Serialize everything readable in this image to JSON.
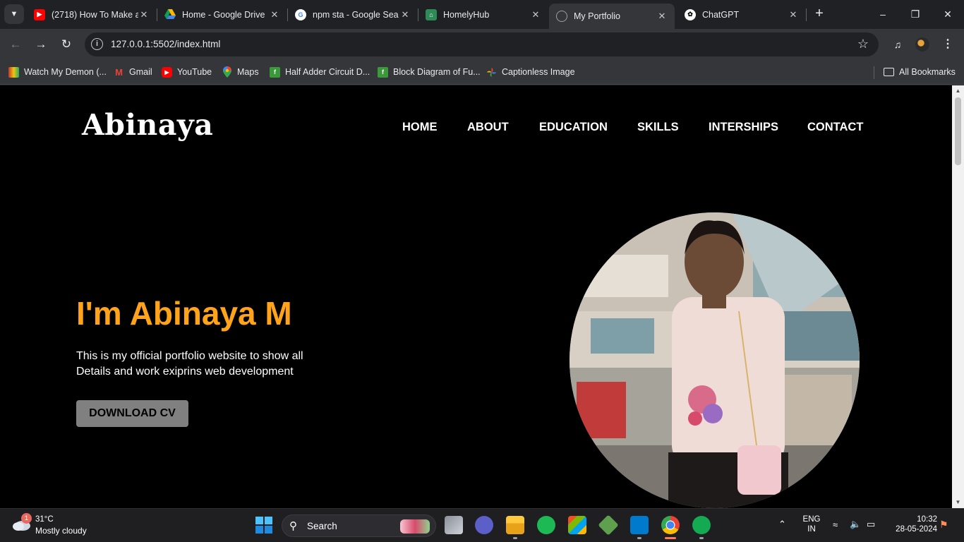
{
  "browser": {
    "tabs": [
      {
        "title": "(2718) How To Make a",
        "icon": "youtube-icon",
        "color": "#ff0000"
      },
      {
        "title": "Home - Google Drive",
        "icon": "google-drive-icon",
        "color": "#1fa463"
      },
      {
        "title": "npm sta - Google Sea",
        "icon": "google-icon",
        "color": "#4285f4"
      },
      {
        "title": "HomelyHub",
        "icon": "house-icon",
        "color": "#2e8b57"
      },
      {
        "title": "My Portfolio",
        "icon": "globe-icon",
        "color": "#9aa0a6",
        "active": true
      },
      {
        "title": "ChatGPT",
        "icon": "chatgpt-icon",
        "color": "#ffffff"
      }
    ],
    "url": "127.0.0.1:5502/index.html",
    "bookmarks": [
      {
        "label": "Watch My Demon (...",
        "icon": "film-icon"
      },
      {
        "label": "Gmail",
        "icon": "gmail-icon"
      },
      {
        "label": "YouTube",
        "icon": "youtube-icon"
      },
      {
        "label": "Maps",
        "icon": "maps-pin-icon"
      },
      {
        "label": "Half Adder Circuit D...",
        "icon": "leaf-icon"
      },
      {
        "label": "Block Diagram of Fu...",
        "icon": "leaf-icon"
      },
      {
        "label": "Captionless Image",
        "icon": "pinwheel-icon"
      }
    ],
    "all_bookmarks": "All Bookmarks"
  },
  "site": {
    "logo": "Abinaya",
    "nav": [
      "HOME",
      "ABOUT",
      "EDUCATION",
      "SKILLS",
      "INTERSHIPS",
      "CONTACT"
    ],
    "hero_title": "I'm Abinaya M",
    "hero_desc_line1": "This is my official portfolio website to show all",
    "hero_desc_line2": "Details and work exiprins web development",
    "cta": "DOWNLOAD CV",
    "accent": "#ffa31a"
  },
  "taskbar": {
    "weather_badge": "1",
    "temp": "31°C",
    "weather": "Mostly cloudy",
    "search": "Search",
    "lang1": "ENG",
    "lang2": "IN",
    "time": "10:32",
    "date": "28-05-2024"
  }
}
